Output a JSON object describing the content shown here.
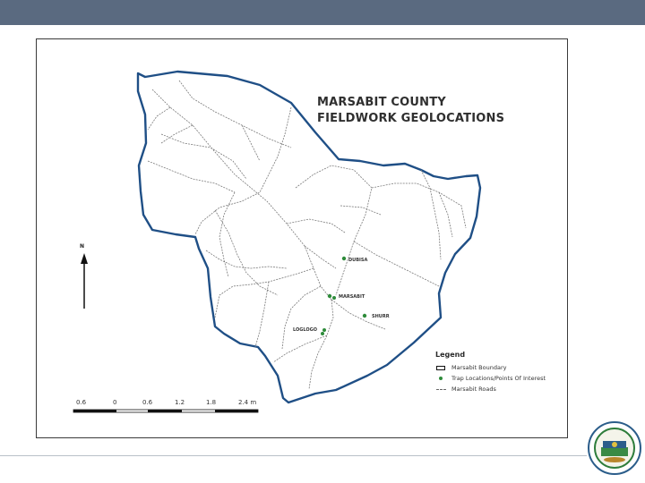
{
  "map": {
    "title_line1": "MARSABIT COUNTY",
    "title_line2": "FIELDWORK GEOLOCATIONS",
    "north_label": "N",
    "places": [
      {
        "id": "dubisa",
        "label": "DUBISA"
      },
      {
        "id": "marsabit",
        "label": "MARSABIT"
      },
      {
        "id": "shurr",
        "label": "SHURR"
      },
      {
        "id": "logologo",
        "label": "LOGLOGO"
      }
    ],
    "legend": {
      "title": "Legend",
      "items": [
        {
          "symbol": "boundary-box",
          "label": "Marsabit Boundary"
        },
        {
          "symbol": "green-dot",
          "label": "Trap Locations/Points Of Interest"
        },
        {
          "symbol": "dashed-line",
          "label": "Marsabit Roads"
        }
      ]
    },
    "scale_bar": {
      "ticks": [
        "0.6",
        "0",
        "0.6",
        "1.2",
        "1.8",
        "2.4 m"
      ]
    },
    "colors": {
      "boundary": "#1f4f86",
      "roads": "#7a7a7a",
      "points": "#2e8b3a"
    }
  },
  "slide": {
    "header_color": "#5a6a80",
    "logo_icon": "county-seal-icon"
  }
}
